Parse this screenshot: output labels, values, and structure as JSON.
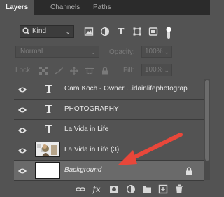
{
  "tabs": [
    {
      "label": "Layers"
    },
    {
      "label": "Channels"
    },
    {
      "label": "Paths"
    }
  ],
  "filter": {
    "kind_label": "Kind",
    "chevron": "⌄"
  },
  "blend": {
    "mode": "Normal",
    "opacity_label": "Opacity:",
    "opacity_value": "100%"
  },
  "lock": {
    "label": "Lock:",
    "fill_label": "Fill:",
    "fill_value": "100%"
  },
  "layers": [
    {
      "name": "Cara Koch - Owner ...idainlifephotograp",
      "type": "text",
      "glyph": "T"
    },
    {
      "name": "PHOTOGRAPHY",
      "type": "text",
      "glyph": "T"
    },
    {
      "name": "La Vida in Life",
      "type": "text",
      "glyph": "T"
    },
    {
      "name": "La Vida in Life (3)",
      "type": "image"
    },
    {
      "name": "Background",
      "type": "background",
      "locked": true,
      "selected": true
    }
  ],
  "annotation": {
    "arrow_color": "#e8473a"
  },
  "colors": {
    "panel": "#535353",
    "tabbar": "#2b2b2b",
    "selected_row": "#6a6a6a"
  }
}
